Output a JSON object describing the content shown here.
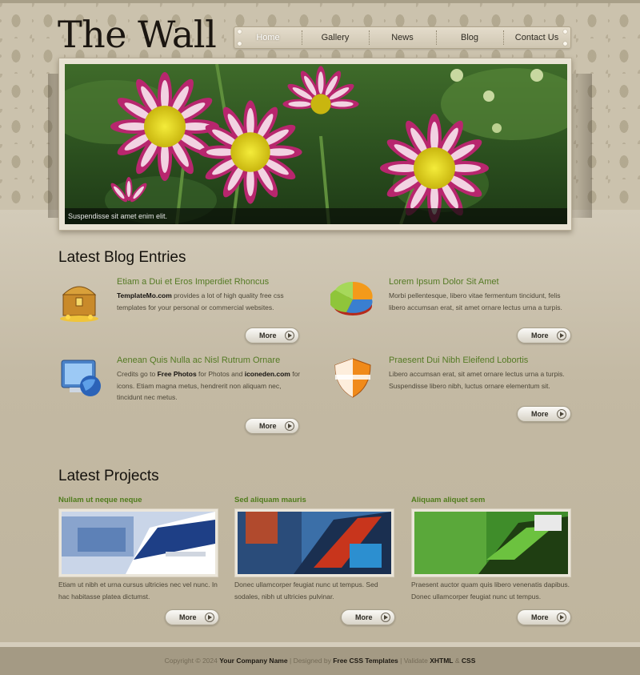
{
  "site": {
    "title": "The Wall"
  },
  "nav": {
    "items": [
      {
        "label": "Home"
      },
      {
        "label": "Gallery"
      },
      {
        "label": "News"
      },
      {
        "label": "Blog"
      },
      {
        "label": "Contact Us"
      }
    ],
    "active_index": 0
  },
  "hero": {
    "caption": "Suspendisse sit amet enim elit."
  },
  "blog": {
    "heading": "Latest Blog Entries",
    "more_label": "More",
    "entries": [
      {
        "title": "Etiam a Dui et Eros Imperdiet Rhoncus",
        "icon": "treasure-chest-icon"
      },
      {
        "title": "Lorem Ipsum Dolor Sit Amet",
        "icon": "pie-chart-icon",
        "text": "Morbi pellentesque, libero vitae fermentum tincidunt, felis libero accumsan erat, sit amet ornare lectus urna a turpis."
      },
      {
        "title": "Aenean Quis Nulla ac Nisl Rutrum Ornare",
        "icon": "monitor-globe-icon"
      },
      {
        "title": "Praesent Dui Nibh Eleifend Lobortis",
        "icon": "shield-icon",
        "text": "Libero accumsan erat, sit amet ornare lectus urna a turpis. Suspendisse libero nibh, luctus ornare elementum sit."
      }
    ],
    "entry0": {
      "bold1": "TemplateMo.com",
      "text1": " provides a lot of high quality free css templates for your personal or commercial websites."
    },
    "entry2": {
      "text1": "Credits go to ",
      "bold1": "Free Photos",
      "text2": " for Photos and ",
      "bold2": "iconeden.com",
      "text3": " for icons. Etiam magna metus, hendrerit non aliquam nec, tincidunt nec metus."
    }
  },
  "projects": {
    "heading": "Latest Projects",
    "more_label": "More",
    "items": [
      {
        "title": "Nullam ut neque neque",
        "text": "Etiam ut nibh et urna cursus ultricies nec vel nunc. In hac habitasse platea dictumst."
      },
      {
        "title": "Sed aliquam mauris",
        "text": "Donec ullamcorper feugiat nunc ut tempus. Sed sodales, nibh ut ultricies pulvinar."
      },
      {
        "title": "Aliquam aliquet sem",
        "text": "Praesent auctor quam quis libero venenatis dapibus. Donec ullamcorper feugiat nunc ut tempus."
      }
    ]
  },
  "footer": {
    "copyright": "Copyright © 2024",
    "company": "Your Company Name",
    "sep1": "|",
    "designed_by": "Designed by",
    "templates": "Free CSS Templates",
    "sep2": "|",
    "validate": "Validate",
    "xhtml": "XHTML",
    "amp": "&",
    "css": "CSS"
  }
}
